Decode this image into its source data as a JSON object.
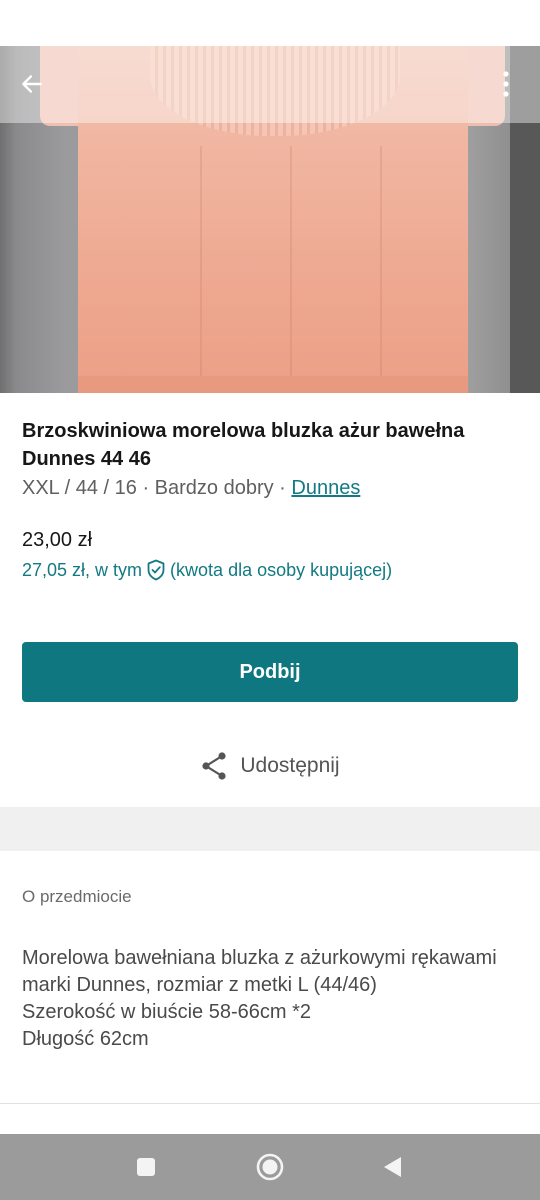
{
  "listing": {
    "title": "Brzoskwiniowa morelowa bluzka ażur bawełna Dunnes 44 46",
    "details_prefix": "XXL / 44 / 16 · Bardzo dobry · ",
    "brand": "Dunnes",
    "price": "23,00 zł",
    "buyer_price_prefix": "27,05 zł, w tym",
    "buyer_price_suffix": "(kwota dla osoby kupującej)"
  },
  "actions": {
    "bump_label": "Podbij",
    "share_label": "Udostępnij"
  },
  "about": {
    "heading": "O przedmiocie",
    "description": "Morelowa bawełniana bluzka z ażurkowymi rękawami marki Dunnes, rozmiar z metki L (44/46)\nSzerokość w biuście 58-66cm *2\nDługość 62cm"
  },
  "icons": {
    "back": "arrow-left-icon",
    "more": "more-vertical-icon",
    "buyer_protection": "shield-check-icon",
    "share": "share-icon",
    "nav_recent": "square-icon",
    "nav_home": "circle-icon",
    "nav_back": "triangle-back-icon"
  },
  "colors": {
    "accent": "#0e7780",
    "link": "#137a84",
    "nav_bar": "#9b9b9b"
  }
}
